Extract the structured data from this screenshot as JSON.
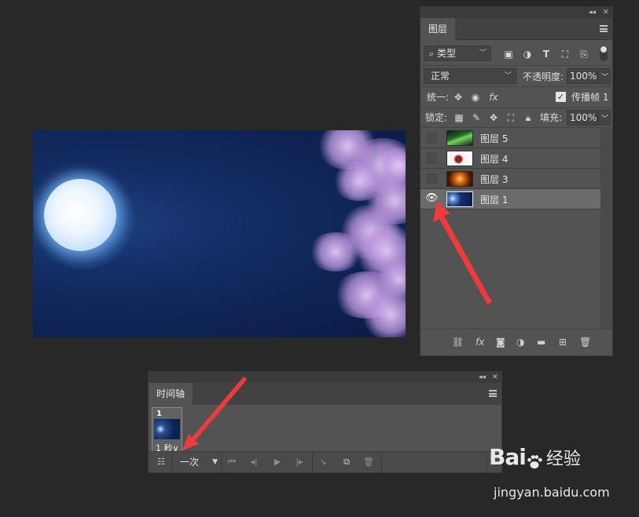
{
  "layers_panel": {
    "tab": "图层",
    "filter": {
      "label": "类型",
      "icon": "search-icon"
    },
    "blend_mode": "正常",
    "opacity_label": "不透明度:",
    "opacity_value": "100%",
    "unify_label": "统一:",
    "propagate_label": "传播帧 1",
    "propagate_checked": true,
    "lock_label": "锁定:",
    "fill_label": "填充:",
    "fill_value": "100%",
    "layers": [
      {
        "name": "图层 5",
        "visible": false,
        "selected": false
      },
      {
        "name": "图层 4",
        "visible": false,
        "selected": false
      },
      {
        "name": "图层 3",
        "visible": false,
        "selected": false
      },
      {
        "name": "图层 1",
        "visible": true,
        "selected": true
      }
    ]
  },
  "timeline_panel": {
    "tab": "时间轴",
    "frame": {
      "number": "1",
      "delay": "1 秒∨"
    },
    "loop": "一次"
  },
  "watermark": {
    "brand": "Bai",
    "brand_suffix": "经验",
    "url": "jingyan.baidu.com"
  },
  "colors": {
    "app_bg": "#282828",
    "panel_bg": "#535353",
    "annotation_arrow": "#f23a3a"
  }
}
